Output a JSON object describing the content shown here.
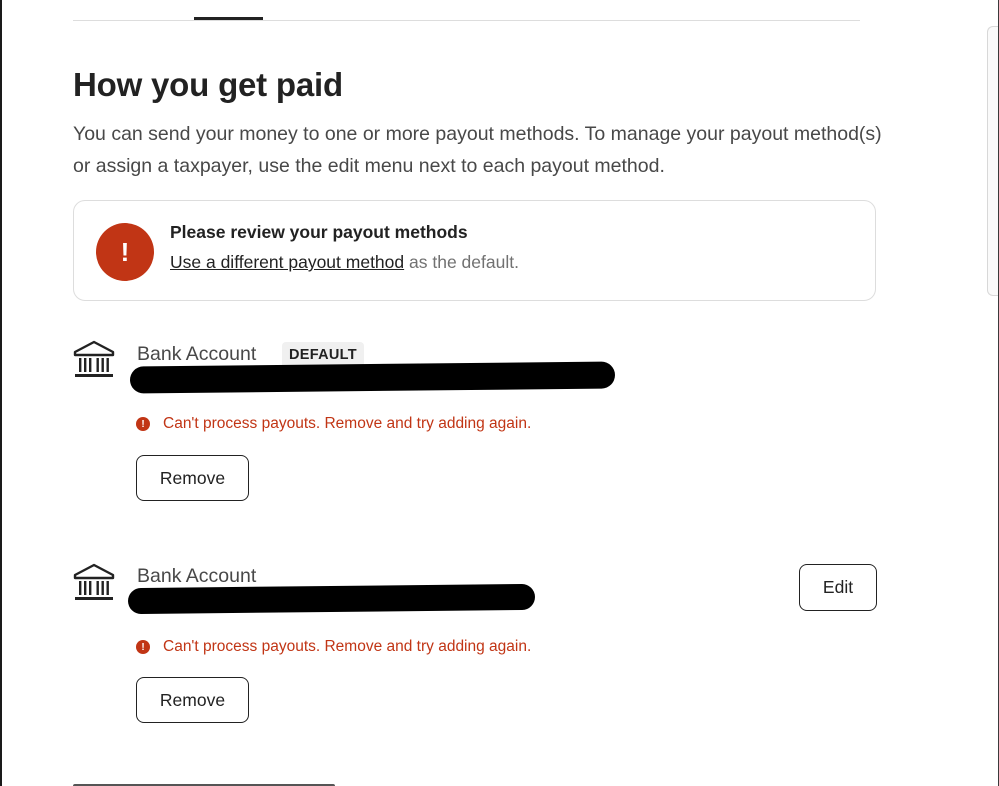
{
  "page": {
    "title": "How you get paid",
    "description": "You can send your money to one or more payout methods. To manage your payout method(s) or assign a taxpayer, use the edit menu next to each payout method."
  },
  "alert": {
    "icon": "exclamation-icon",
    "icon_glyph": "!",
    "title": "Please review your payout methods",
    "link_text": "Use a different payout method",
    "trailing_text": " as the default.",
    "color": "#c13515"
  },
  "payout_methods": [
    {
      "label": "Bank Account",
      "badge": "DEFAULT",
      "icon": "bank-icon",
      "error": "Can't process payouts. Remove and try adding again.",
      "remove_label": "Remove"
    },
    {
      "label": "Bank Account",
      "icon": "bank-icon",
      "error": "Can't process payouts. Remove and try adding again.",
      "remove_label": "Remove",
      "edit_label": "Edit"
    }
  ],
  "colors": {
    "error": "#c13515",
    "text_primary": "#222222",
    "text_secondary": "#717171",
    "border": "#dddddd"
  }
}
